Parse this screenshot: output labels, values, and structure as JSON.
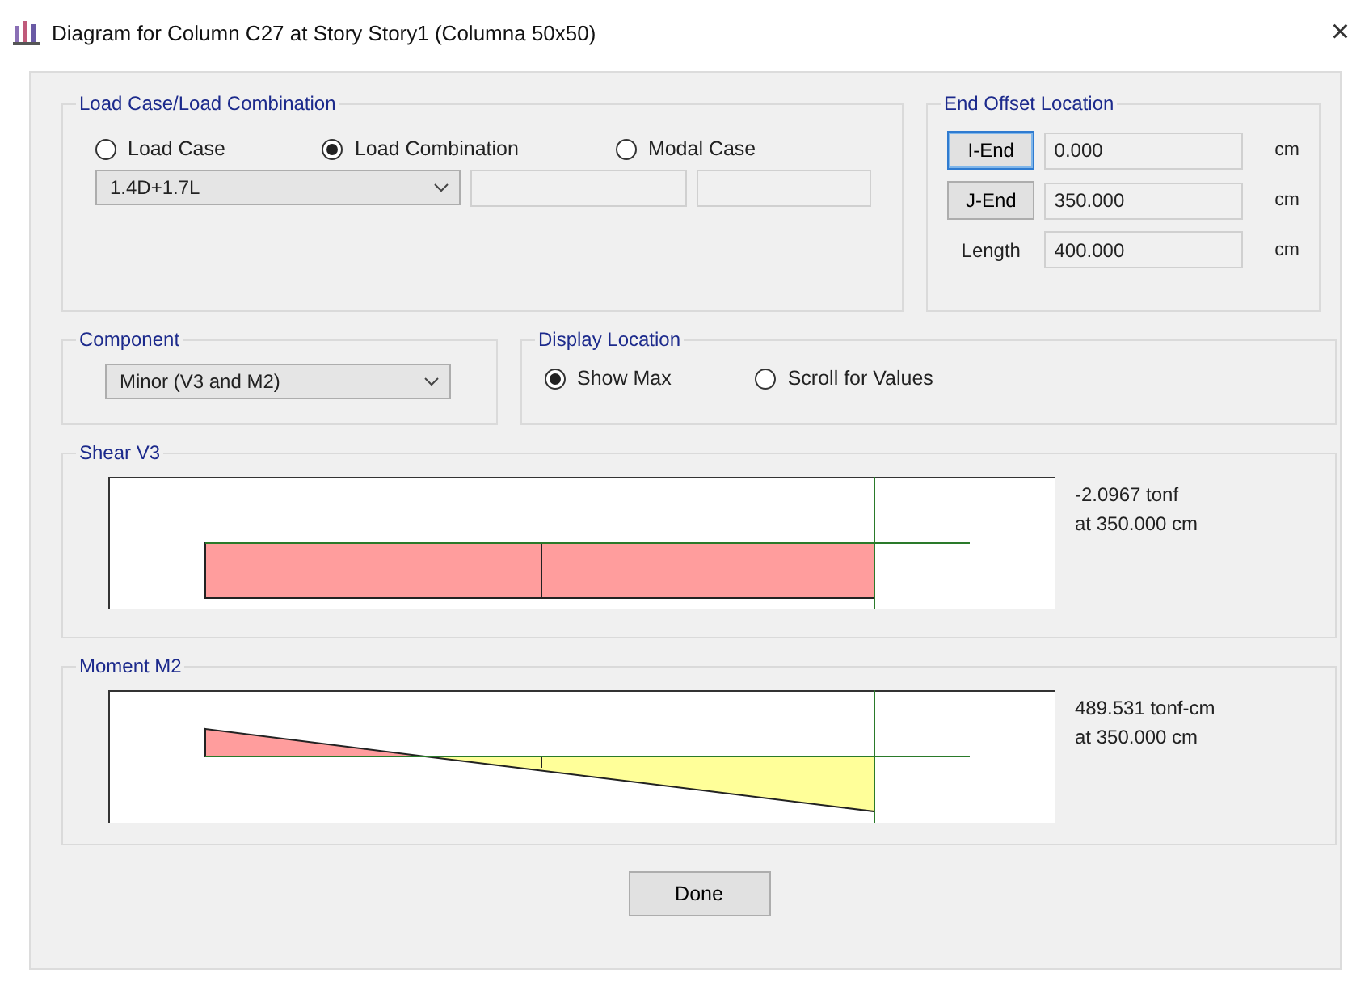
{
  "window": {
    "title": "Diagram for Column C27 at Story Story1 (Columna 50x50)",
    "close": "×"
  },
  "load_case": {
    "title": "Load Case/Load Combination",
    "options": [
      {
        "label": "Load Case",
        "selected": false
      },
      {
        "label": "Load Combination",
        "selected": true
      },
      {
        "label": "Modal Case",
        "selected": false
      }
    ],
    "combo": "1.4D+1.7L"
  },
  "end_offset": {
    "title": "End Offset Location",
    "rows": [
      {
        "kind": "button",
        "label": "I-End",
        "value": "0.000",
        "unit": "cm",
        "focused": true
      },
      {
        "kind": "button",
        "label": "J-End",
        "value": "350.000",
        "unit": "cm",
        "focused": false
      },
      {
        "kind": "label",
        "label": "Length",
        "value": "400.000",
        "unit": "cm"
      }
    ]
  },
  "component": {
    "title": "Component",
    "value": "Minor (V3 and M2)"
  },
  "display_location": {
    "title": "Display Location",
    "options": [
      {
        "label": "Show Max",
        "selected": true
      },
      {
        "label": "Scroll for Values",
        "selected": false
      }
    ]
  },
  "diagrams": [
    {
      "kind": "shear",
      "title": "Shear V3",
      "value": "-2.0967 tonf",
      "location": "at 350.000 cm"
    },
    {
      "kind": "moment",
      "title": "Moment M2",
      "value": "489.531 tonf-cm",
      "location": "at 350.000 cm"
    }
  ],
  "buttons": {
    "done": "Done"
  }
}
